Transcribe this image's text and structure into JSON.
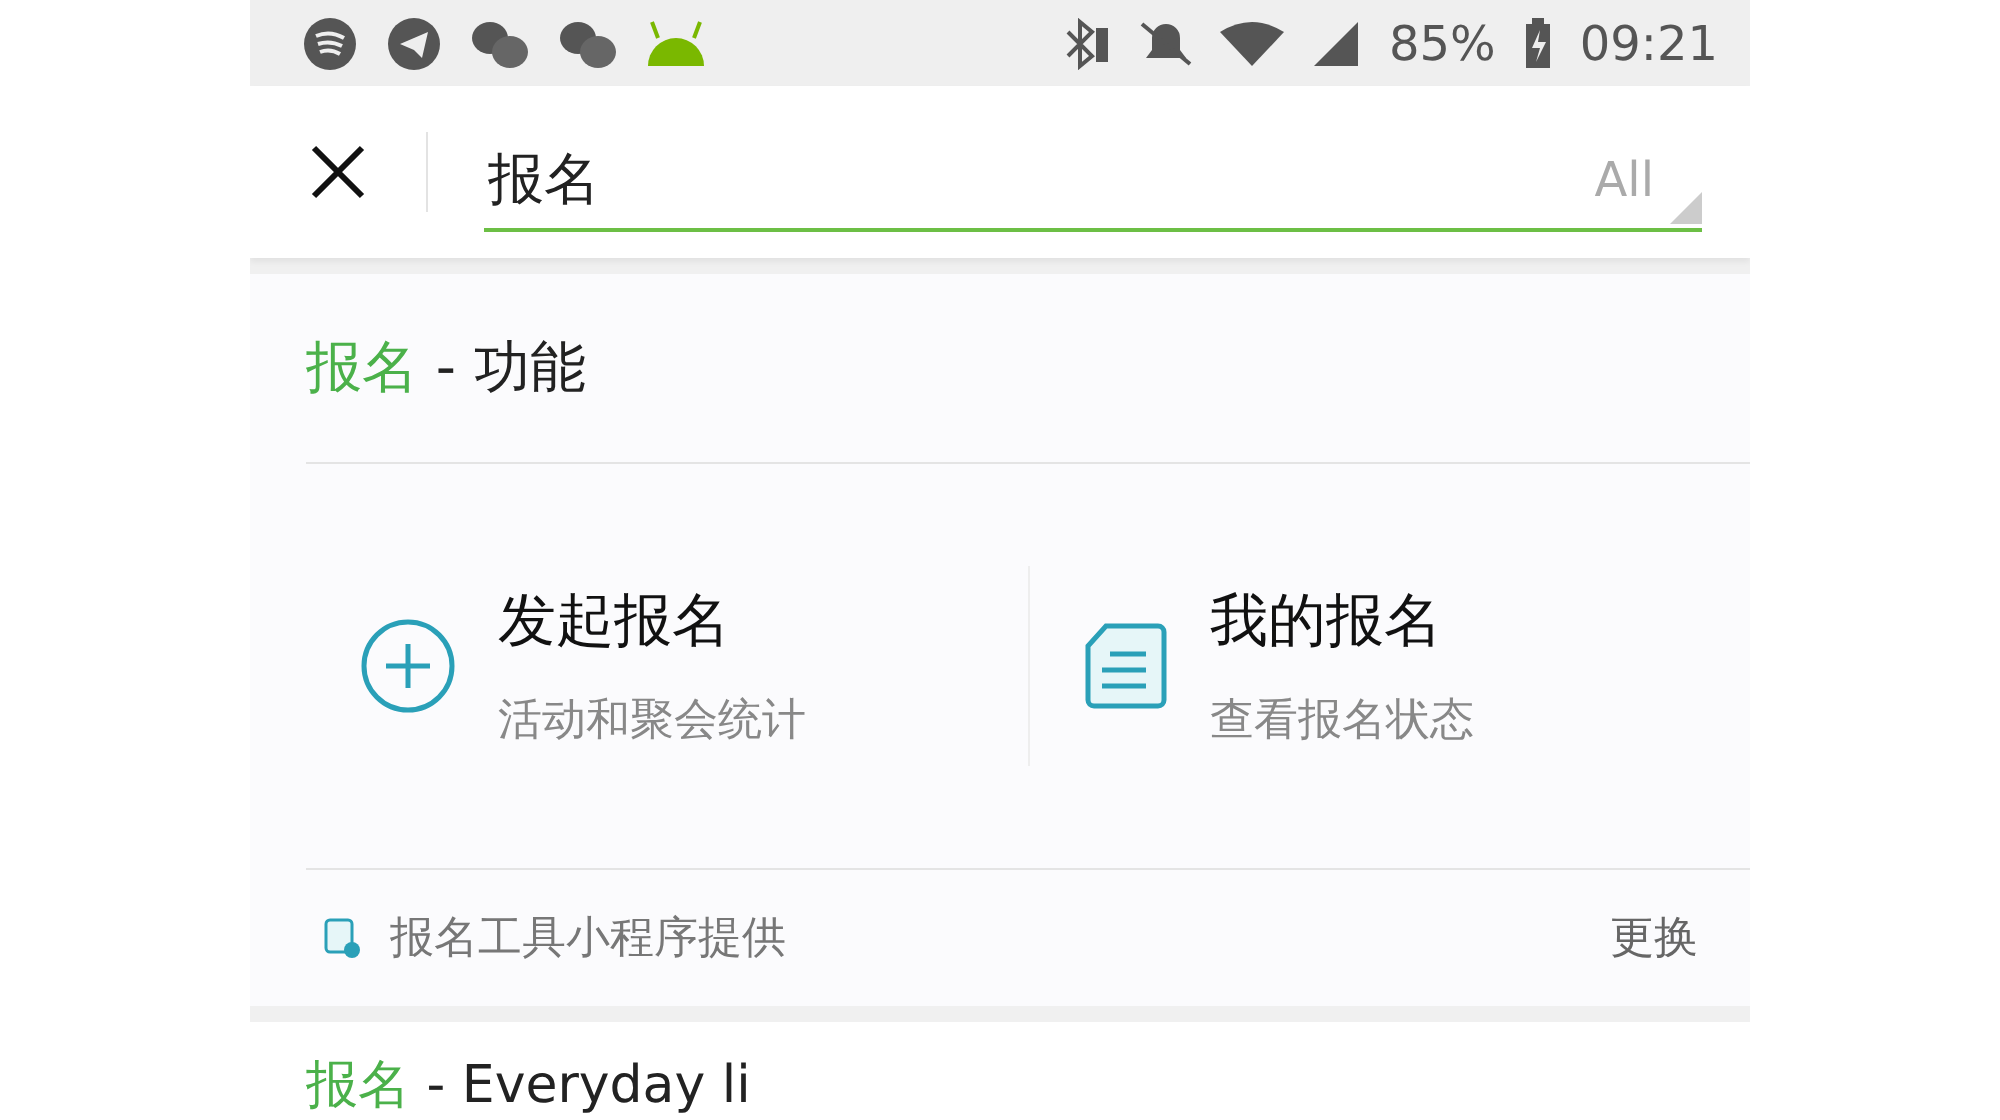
{
  "status_bar": {
    "battery": "85%",
    "time": "09:21"
  },
  "search": {
    "value": "报名",
    "filter": "All"
  },
  "sections": [
    {
      "keyword": "报名",
      "suffix": " - 功能",
      "actions": [
        {
          "kind": "create",
          "title": "发起报名",
          "subtitle": "活动和聚会统计"
        },
        {
          "kind": "document",
          "title": "我的报名",
          "subtitle": "查看报名状态"
        }
      ],
      "footer": {
        "provider": "报名工具小程序提供",
        "link": "更换"
      }
    },
    {
      "keyword": "报名",
      "suffix": " - Everyday li"
    }
  ]
}
